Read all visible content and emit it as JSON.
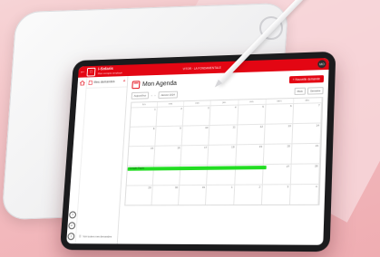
{
  "app": {
    "brand_title": "i-Solaris",
    "brand_subtitle": "Mon compte employé",
    "center_label": "VITOR · LA FONDAMENTALE",
    "avatar_initials": "MO",
    "accent_color": "#e30613"
  },
  "sidebar": {
    "item_label": "Mes demandes",
    "see_all_label": "Voir toutes mes demandes"
  },
  "main": {
    "title": "Mon Agenda",
    "new_button_label": "+ Nouvelle demande",
    "toolbar": {
      "today_label": "Aujourd'hui",
      "month_label": "Janvier 2024",
      "view_month": "Mois",
      "view_week": "Semaine"
    },
    "weekdays": [
      "lun.",
      "mar.",
      "mer.",
      "jeu.",
      "ven.",
      "sam.",
      "dim."
    ],
    "weeks": [
      [
        "1",
        "2",
        "3",
        "4",
        "5",
        "6",
        "7"
      ],
      [
        "8",
        "9",
        "10",
        "11",
        "12",
        "13",
        "14"
      ],
      [
        "15",
        "16",
        "17",
        "18",
        "19",
        "20",
        "21"
      ],
      [
        "22",
        "23",
        "24",
        "25",
        "26",
        "27",
        "28"
      ],
      [
        "29",
        "30",
        "31",
        "1",
        "2",
        "3",
        "4"
      ]
    ],
    "event": {
      "label": "Congés Payés",
      "color": "#22dd22"
    }
  },
  "icons": {
    "back": "arrow-left-icon",
    "home": "home-icon",
    "help": "question-icon",
    "logout": "logout-icon",
    "info": "info-icon"
  }
}
